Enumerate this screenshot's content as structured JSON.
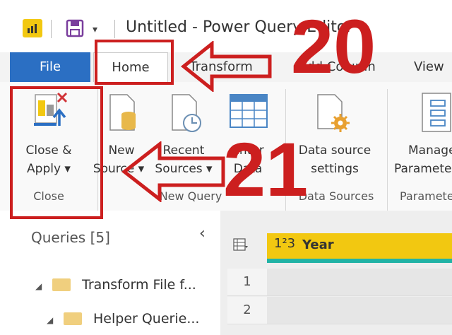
{
  "window": {
    "title": "Untitled - Power Query Editor"
  },
  "tabs": [
    "File",
    "Home",
    "Transform",
    "Add Column",
    "View"
  ],
  "ribbon": {
    "close_apply": {
      "line1": "Close &",
      "line2": "Apply",
      "group": "Close"
    },
    "new_source": {
      "line1": "New",
      "line2": "Source"
    },
    "recent_sources": {
      "line1": "Recent",
      "line2": "Sources"
    },
    "enter_data": {
      "line1": "Enter",
      "line2": "Data"
    },
    "new_query_group": "New Query",
    "data_source_settings": {
      "line1": "Data source",
      "line2": "settings",
      "group": "Data Sources"
    },
    "manage_parameters": {
      "line1": "Manage",
      "line2": "Parameters",
      "group": "Parameters"
    }
  },
  "queries": {
    "title": "Queries [5]",
    "items": [
      {
        "label": "Transform File f..."
      },
      {
        "label": "Helper Querie..."
      }
    ]
  },
  "grid": {
    "type_badge": "1²3",
    "column": "Year",
    "row_numbers": [
      "1",
      "2"
    ]
  },
  "annotations": {
    "label_20": "20",
    "label_21": "21"
  },
  "colors": {
    "file_tab": "#2b6fc3",
    "accent": "#f2c811",
    "annotation": "#cc1f1f",
    "band": "#22b3a6"
  }
}
